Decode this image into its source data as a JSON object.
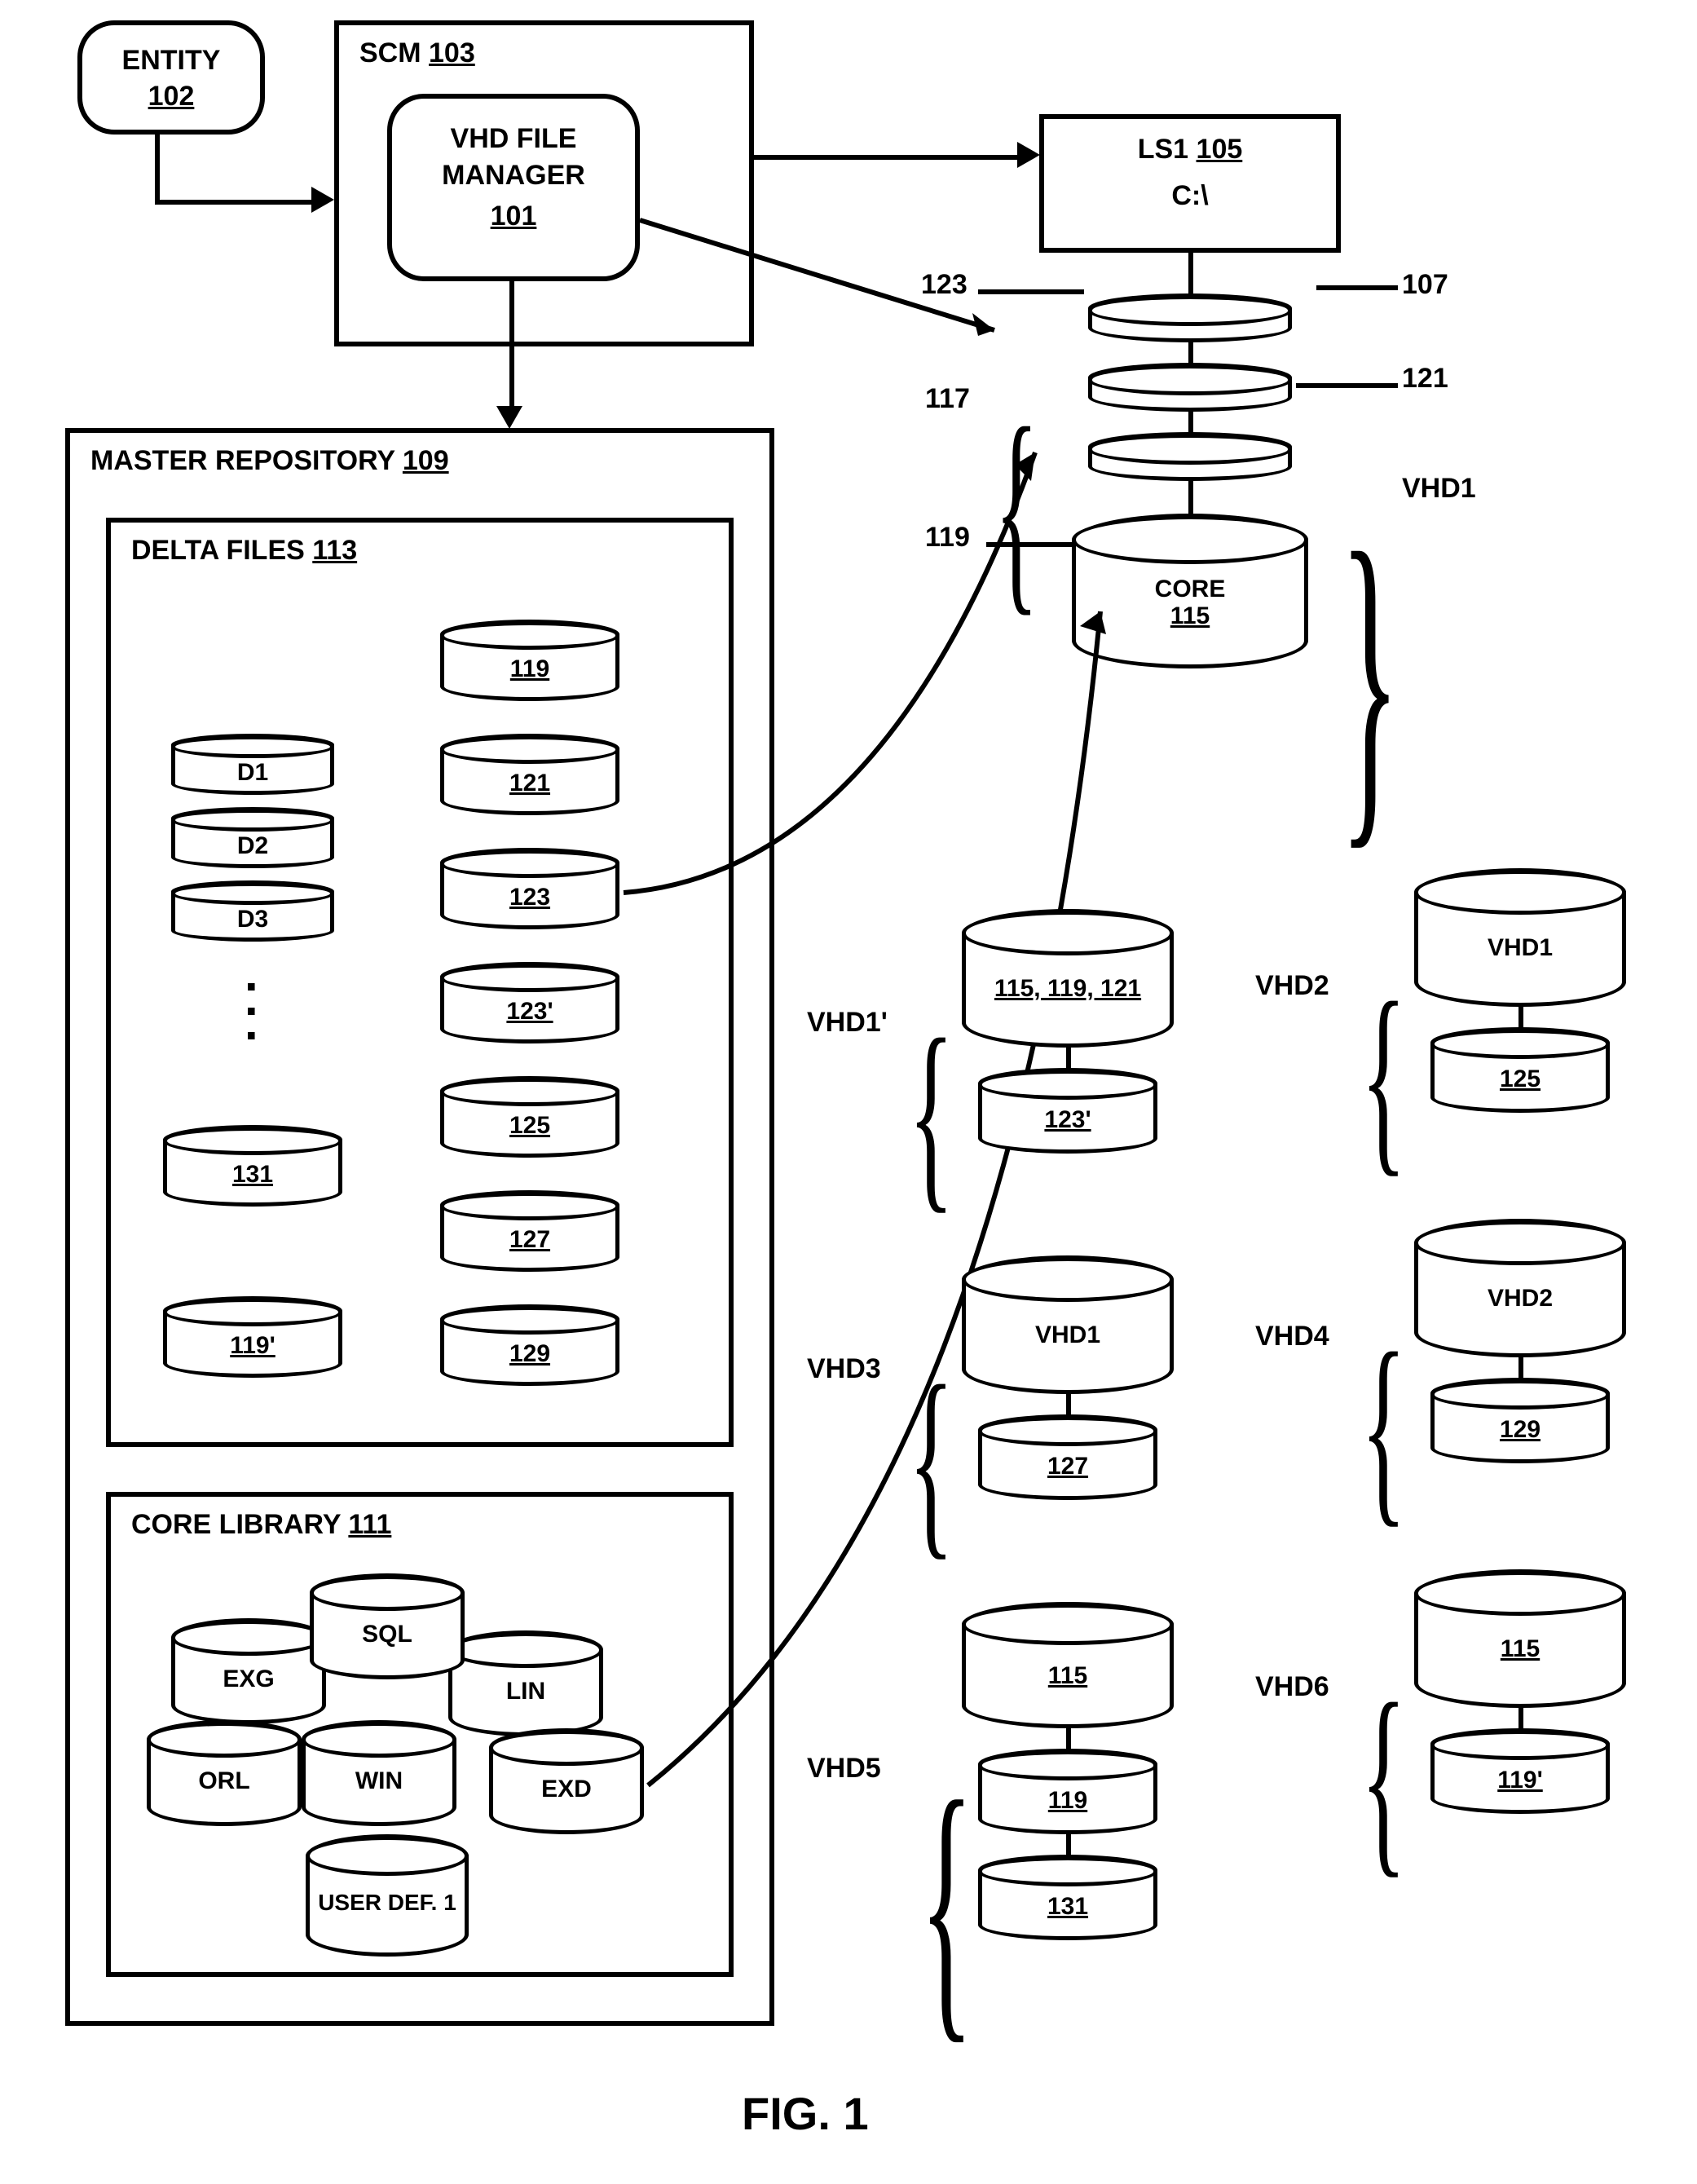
{
  "entity": {
    "label": "ENTITY",
    "ref": "102"
  },
  "scm": {
    "label": "SCM",
    "ref": "103"
  },
  "vhdmgr": {
    "label1": "VHD FILE",
    "label2": "MANAGER",
    "ref": "101"
  },
  "ls1": {
    "label": "LS1",
    "ref": "105",
    "drive": "C:\\"
  },
  "ls1_refs": {
    "a": "123",
    "b": "107",
    "c": "117",
    "d": "121",
    "e": "119",
    "grp": "VHD1"
  },
  "core": {
    "label": "CORE",
    "ref": "115"
  },
  "master": {
    "label": "MASTER REPOSITORY",
    "ref": "109"
  },
  "delta": {
    "label": "DELTA FILES",
    "ref": "113"
  },
  "delta_left": [
    "D1",
    "D2",
    "D3"
  ],
  "delta_left_extra": [
    "131",
    "119'"
  ],
  "delta_right": [
    "119",
    "121",
    "123",
    "123'",
    "125",
    "127",
    "129"
  ],
  "corelib": {
    "label": "CORE LIBRARY",
    "ref": "111"
  },
  "corelib_items": [
    "EXG",
    "SQL",
    "LIN",
    "ORL",
    "WIN",
    "EXD",
    "USER DEF. 1"
  ],
  "vhds": {
    "vhd1p": {
      "name": "VHD1'",
      "top": "115, 119, 121",
      "bot": "123'"
    },
    "vhd2": {
      "name": "VHD2",
      "top": "VHD1",
      "bot": "125"
    },
    "vhd3": {
      "name": "VHD3",
      "top": "VHD1",
      "bot": "127"
    },
    "vhd4": {
      "name": "VHD4",
      "top": "VHD2",
      "bot": "129"
    },
    "vhd5": {
      "name": "VHD5",
      "top": "115",
      "mid": "119",
      "bot": "131"
    },
    "vhd6": {
      "name": "VHD6",
      "top": "115",
      "bot": "119'"
    }
  },
  "figure": "FIG. 1"
}
